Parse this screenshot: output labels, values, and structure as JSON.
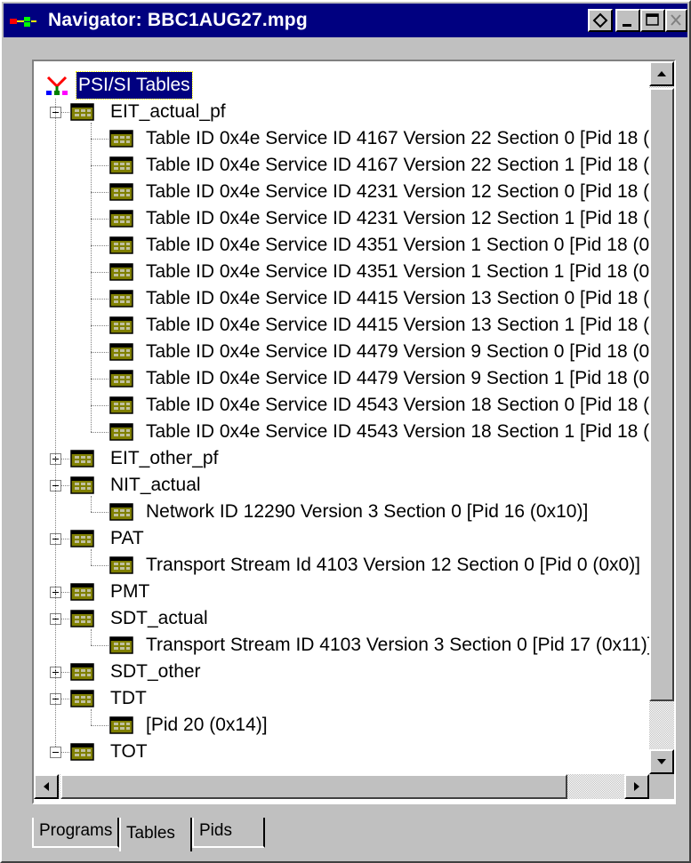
{
  "window": {
    "title": "Navigator: BBC1AUG27.mpg",
    "buttons": [
      "restore",
      "minimize",
      "maximize",
      "close"
    ]
  },
  "tree": {
    "root": "PSI/SI Tables",
    "nodes": [
      {
        "label": "EIT_actual_pf",
        "expanded": true,
        "children": [
          "Table ID 0x4e Service ID 4167 Version 22 Section 0 [Pid 18 (",
          "Table ID 0x4e Service ID 4167 Version 22 Section 1 [Pid 18 (",
          "Table ID 0x4e Service ID 4231 Version 12 Section 0 [Pid 18 (",
          "Table ID 0x4e Service ID 4231 Version 12 Section 1 [Pid 18 (",
          "Table ID 0x4e Service ID 4351 Version 1 Section 0 [Pid 18 (0",
          "Table ID 0x4e Service ID 4351 Version 1 Section 1 [Pid 18 (0",
          "Table ID 0x4e Service ID 4415 Version 13 Section 0 [Pid 18 (",
          "Table ID 0x4e Service ID 4415 Version 13 Section 1 [Pid 18 (",
          "Table ID 0x4e Service ID 4479 Version 9 Section 0 [Pid 18 (0",
          "Table ID 0x4e Service ID 4479 Version 9 Section 1 [Pid 18 (0",
          "Table ID 0x4e Service ID 4543 Version 18 Section 0 [Pid 18 (",
          "Table ID 0x4e Service ID 4543 Version 18 Section 1 [Pid 18 ("
        ]
      },
      {
        "label": "EIT_other_pf",
        "expanded": false,
        "children": []
      },
      {
        "label": "NIT_actual",
        "expanded": true,
        "children": [
          "Network ID 12290 Version 3 Section 0 [Pid 16 (0x10)]"
        ]
      },
      {
        "label": "PAT",
        "expanded": true,
        "children": [
          "Transport Stream Id 4103 Version 12 Section 0 [Pid 0 (0x0)]"
        ]
      },
      {
        "label": "PMT",
        "expanded": false,
        "children": []
      },
      {
        "label": "SDT_actual",
        "expanded": true,
        "children": [
          "Transport Stream ID 4103 Version 3 Section 0 [Pid 17 (0x11)]"
        ]
      },
      {
        "label": "SDT_other",
        "expanded": false,
        "children": []
      },
      {
        "label": "TDT",
        "expanded": true,
        "children": [
          "[Pid 20 (0x14)]"
        ]
      },
      {
        "label": "TOT",
        "expanded": true,
        "children": []
      }
    ]
  },
  "tabs": [
    {
      "label": "Programs",
      "active": false
    },
    {
      "label": "Tables",
      "active": true
    },
    {
      "label": "Pids",
      "active": false
    }
  ],
  "colors": {
    "title_bar": "#000080",
    "face": "#c0c0c0",
    "folder_icon": "#808000",
    "selection": "#000080"
  }
}
